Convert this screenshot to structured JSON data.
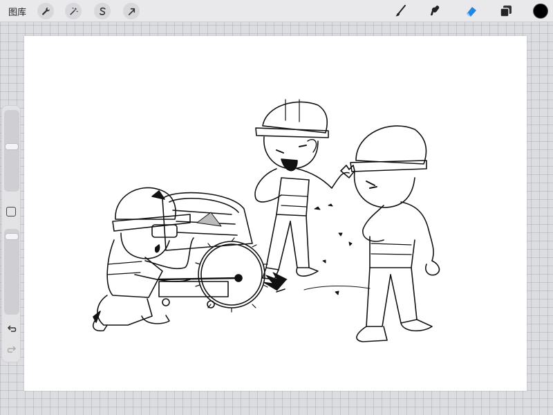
{
  "app": {
    "gallery_label": "图库"
  },
  "toolbar": {
    "left_tools": [
      {
        "name": "actions",
        "icon": "wrench-icon"
      },
      {
        "name": "adjustments",
        "icon": "magic-wand-icon"
      },
      {
        "name": "selection",
        "icon": "selection-s-icon"
      },
      {
        "name": "transform",
        "icon": "arrow-cursor-icon"
      }
    ],
    "right_tools": [
      {
        "name": "brush",
        "icon": "brush-icon",
        "active": false
      },
      {
        "name": "smudge",
        "icon": "smudge-icon",
        "active": false
      },
      {
        "name": "eraser",
        "icon": "eraser-icon",
        "active": true
      },
      {
        "name": "layers",
        "icon": "layers-icon",
        "active": false
      }
    ],
    "current_color": "#000000",
    "active_tool_color": "#1e88e5"
  },
  "sidebar": {
    "brush_size_level": 0.3,
    "opacity_level": 0.08,
    "undo_icon": "undo-icon",
    "redo_icon": "redo-icon",
    "modify_icon": "square-modify-icon"
  },
  "canvas": {
    "background": "#ffffff",
    "drawing_description_icon": "artwork-icon"
  }
}
